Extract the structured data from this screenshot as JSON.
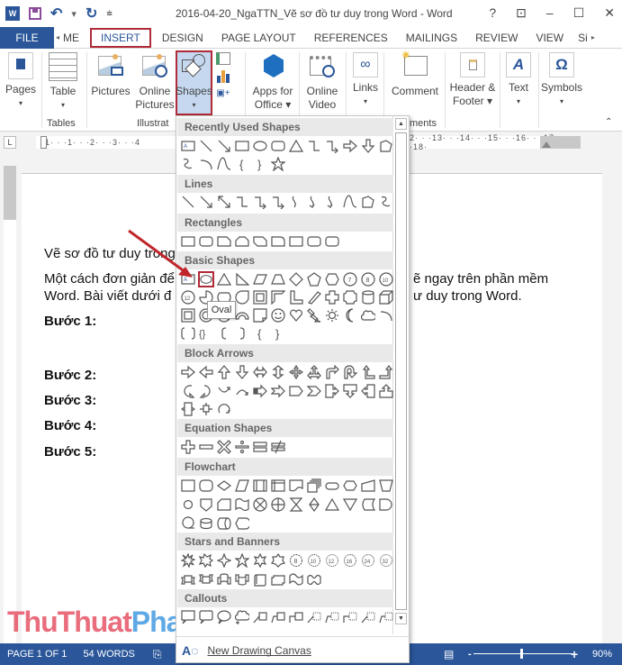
{
  "window": {
    "title": "2016-04-20_NgaTTN_Vẽ sơ đồ tư duy trong Word - Word",
    "controls": [
      "?",
      "restore-ribbon",
      "minimize",
      "maximize",
      "close"
    ]
  },
  "quick_access": {
    "app_icon": "W",
    "icons": [
      "word-icon",
      "save-icon",
      "undo-icon",
      "redo-icon",
      "customize-icon"
    ]
  },
  "tabs": [
    {
      "label": "FILE"
    },
    {
      "label": "◂"
    },
    {
      "label": "ME"
    },
    {
      "label": "INSERT",
      "active": true
    },
    {
      "label": "DESIGN"
    },
    {
      "label": "PAGE LAYOUT"
    },
    {
      "label": "REFERENCES"
    },
    {
      "label": "MAILINGS"
    },
    {
      "label": "REVIEW"
    },
    {
      "label": "VIEW"
    },
    {
      "label": "Si"
    },
    {
      "label": "▸"
    }
  ],
  "ribbon": {
    "buttons": {
      "pages": "Pages",
      "table": "Table",
      "pictures": "Pictures",
      "online_pictures_1": "Online",
      "online_pictures_2": "Pictures",
      "shapes": "Shapes",
      "apps_1": "Apps for",
      "apps_2": "Office ▾",
      "online_video_1": "Online",
      "online_video_2": "Video",
      "links": "Links",
      "comment": "Comment",
      "header_footer_1": "Header &",
      "header_footer_2": "Footer ▾",
      "text": "Text",
      "symbols": "Symbols"
    },
    "groups": {
      "tables": "Tables",
      "illustrations": "Illustrat",
      "comments": "ments"
    }
  },
  "ruler": {
    "left_numbers": "·1· · ·1· · ·2· · ·3· · ·4",
    "right_numbers": "2· · ·13· · ·14· · ·15· · ·16· · ·17· · ·18·",
    "tab_selector": "L"
  },
  "document": {
    "lines": [
      {
        "text": "Vẽ sơ đồ tư duy trong",
        "bold": false
      },
      {
        "text": "Một cách đơn giản để",
        "bold": false,
        "tail": "ẽ ngay trên phần mềm"
      },
      {
        "text": "Word. Bài viết dưới đ",
        "bold": false,
        "tail": "ư duy trong Word."
      },
      {
        "text": "Bước 1:",
        "bold": true
      },
      {
        "text": "Bước 2:",
        "bold": true
      },
      {
        "text": "Bước 3:",
        "bold": true
      },
      {
        "text": "Bước 4:",
        "bold": true
      },
      {
        "text": "Bước 5:",
        "bold": true
      }
    ]
  },
  "shapes_gallery": {
    "categories": [
      "Recently Used Shapes",
      "Lines",
      "Rectangles",
      "Basic Shapes",
      "Block Arrows",
      "Equation Shapes",
      "Flowchart",
      "Stars and Banners",
      "Callouts"
    ],
    "selected_shape": "Oval",
    "tooltip": "Oval",
    "new_canvas_label": "New Drawing Canvas"
  },
  "status_bar": {
    "page": "PAGE 1 OF 1",
    "words": "54 WORDS",
    "zoom": "90%",
    "zoom_percent": 90
  },
  "watermark": {
    "part1": "ThuThuat",
    "part2": "PhanMem.vn"
  },
  "colors": {
    "accent": "#2b579a",
    "highlight": "#b02a37",
    "selected_button": "#c5d8f0"
  }
}
